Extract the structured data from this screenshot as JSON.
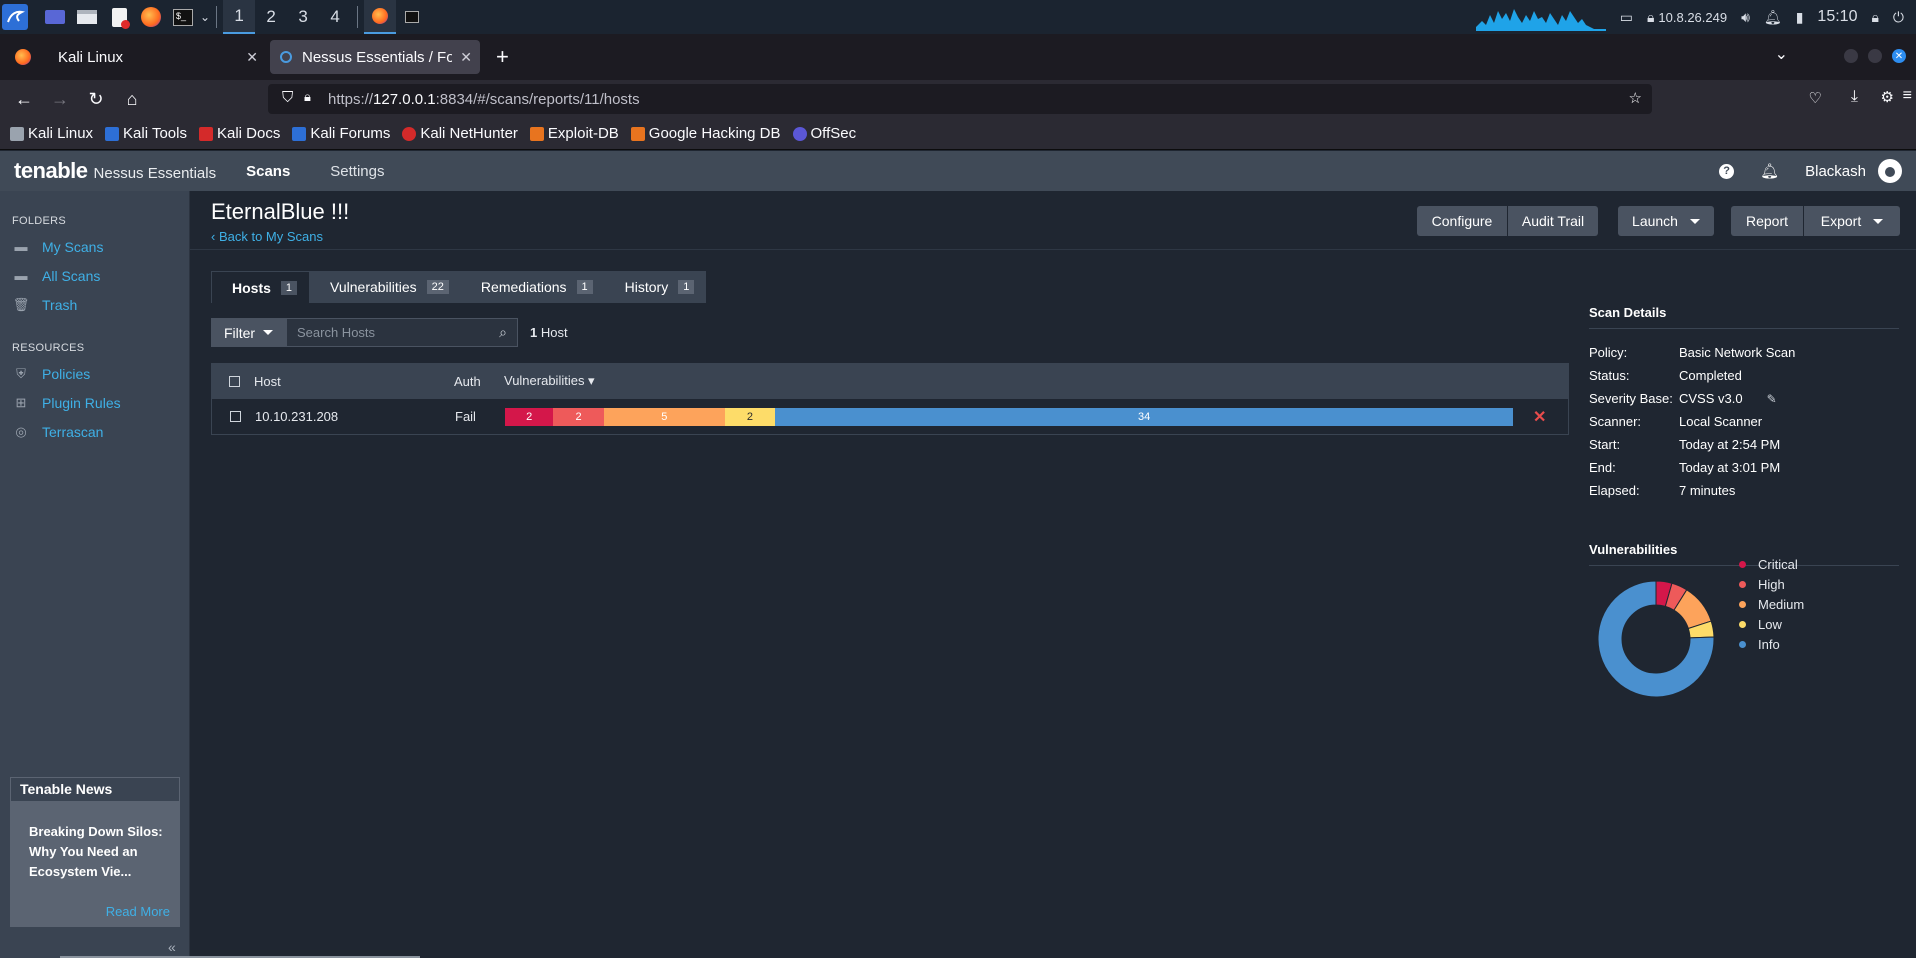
{
  "taskbar": {
    "workspaces": [
      "1",
      "2",
      "3",
      "4"
    ],
    "ip": "10.8.26.249",
    "time": "15:10"
  },
  "browser": {
    "tabs": [
      {
        "label": "Kali Linux"
      },
      {
        "label": "Nessus Essentials / Folde"
      }
    ],
    "url_prefix": "https://",
    "url_host": "127.0.0.1",
    "url_rest": ":8834/#/scans/reports/11/hosts",
    "bookmarks": [
      "Kali Linux",
      "Kali Tools",
      "Kali Docs",
      "Kali Forums",
      "Kali NetHunter",
      "Exploit-DB",
      "Google Hacking DB",
      "OffSec"
    ]
  },
  "app": {
    "logo_brand": "tenable",
    "logo_product": "Nessus Essentials",
    "nav": [
      "Scans",
      "Settings"
    ],
    "help": "?",
    "user": "Blackash"
  },
  "sidebar": {
    "folders_heading": "FOLDERS",
    "folders": [
      "My Scans",
      "All Scans",
      "Trash"
    ],
    "resources_heading": "RESOURCES",
    "resources": [
      "Policies",
      "Plugin Rules",
      "Terrascan"
    ],
    "news_heading": "Tenable News",
    "news_text": "Breaking Down Silos: Why You Need an Ecosystem Vie...",
    "news_more": "Read More",
    "collapse": "«"
  },
  "scan": {
    "title": "EternalBlue !!!",
    "back": "Back to My Scans",
    "buttons": {
      "configure": "Configure",
      "audit": "Audit Trail",
      "launch": "Launch",
      "report": "Report",
      "export": "Export"
    },
    "tabs": [
      {
        "label": "Hosts",
        "count": "1"
      },
      {
        "label": "Vulnerabilities",
        "count": "22"
      },
      {
        "label": "Remediations",
        "count": "1"
      },
      {
        "label": "History",
        "count": "1"
      }
    ],
    "filter": "Filter",
    "search_placeholder": "Search Hosts",
    "host_count_num": "1",
    "host_count_label": "Host",
    "columns": {
      "host": "Host",
      "auth": "Auth",
      "vulns": "Vulnerabilities ▾"
    },
    "rows": [
      {
        "host": "10.10.231.208",
        "auth": "Fail",
        "critical": "2",
        "high": "2",
        "medium": "5",
        "low": "2",
        "info": "34"
      }
    ]
  },
  "details": {
    "heading": "Scan Details",
    "items": [
      {
        "k": "Policy:",
        "v": "Basic Network Scan"
      },
      {
        "k": "Status:",
        "v": "Completed"
      },
      {
        "k": "Severity Base:",
        "v": "CVSS v3.0"
      },
      {
        "k": "Scanner:",
        "v": "Local Scanner"
      },
      {
        "k": "Start:",
        "v": "Today at 2:54 PM"
      },
      {
        "k": "End:",
        "v": "Today at 3:01 PM"
      },
      {
        "k": "Elapsed:",
        "v": "7 minutes"
      }
    ],
    "vuln_heading": "Vulnerabilities",
    "legend": [
      "Critical",
      "High",
      "Medium",
      "Low",
      "Info"
    ]
  },
  "colors": {
    "critical": "#d4174a",
    "high": "#ee5a5a",
    "medium": "#fda35b",
    "low": "#fddc69",
    "info": "#4a90cf",
    "link": "#3fb0e6"
  },
  "chart_data": {
    "type": "pie",
    "categories": [
      "Critical",
      "High",
      "Medium",
      "Low",
      "Info"
    ],
    "values": [
      2,
      2,
      5,
      2,
      34
    ]
  }
}
